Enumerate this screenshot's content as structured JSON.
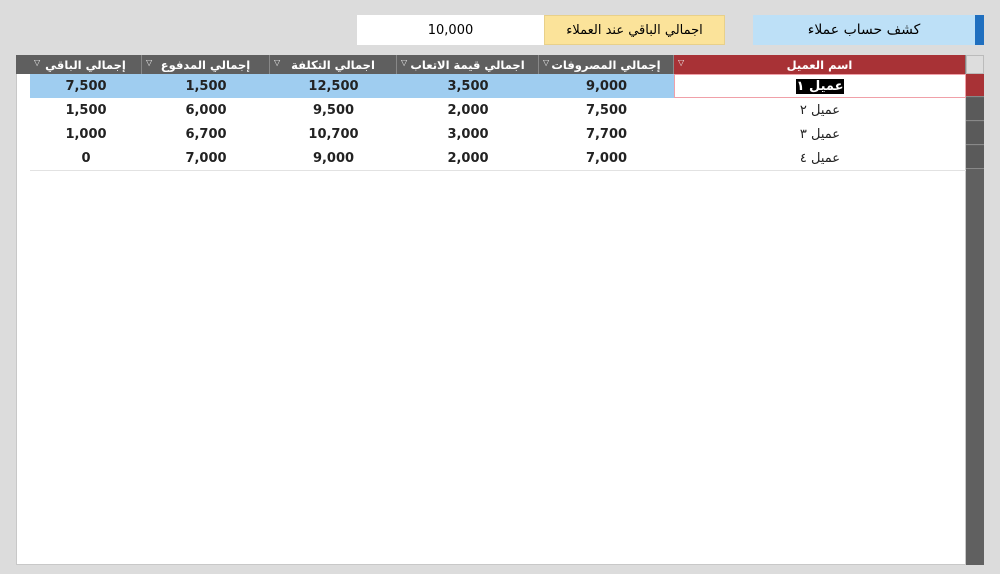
{
  "header": {
    "title": "كشف حساب عملاء",
    "total_label": "اجمالي الباقي عند العملاء",
    "total_value": "10,000"
  },
  "table": {
    "columns": [
      "إجمالي الباقي",
      "إجمالي المدفوع",
      "اجمالي التكلفة",
      "اجمالي قيمة الاتعاب",
      "إجمالي المصروفات",
      "اسم العميل"
    ],
    "rows": [
      [
        "7,500",
        "1,500",
        "12,500",
        "3,500",
        "9,000",
        "عميل ١"
      ],
      [
        "1,500",
        "6,000",
        "9,500",
        "2,000",
        "7,500",
        "عميل ٢"
      ],
      [
        "1,000",
        "6,700",
        "10,700",
        "3,000",
        "7,700",
        "عميل ٣"
      ],
      [
        "0",
        "7,000",
        "9,000",
        "2,000",
        "7,000",
        "عميل ٤"
      ]
    ]
  },
  "colors": {
    "accent": "#a83236",
    "selected_row": "#9fcdf0",
    "header": "#5f5f5f"
  }
}
